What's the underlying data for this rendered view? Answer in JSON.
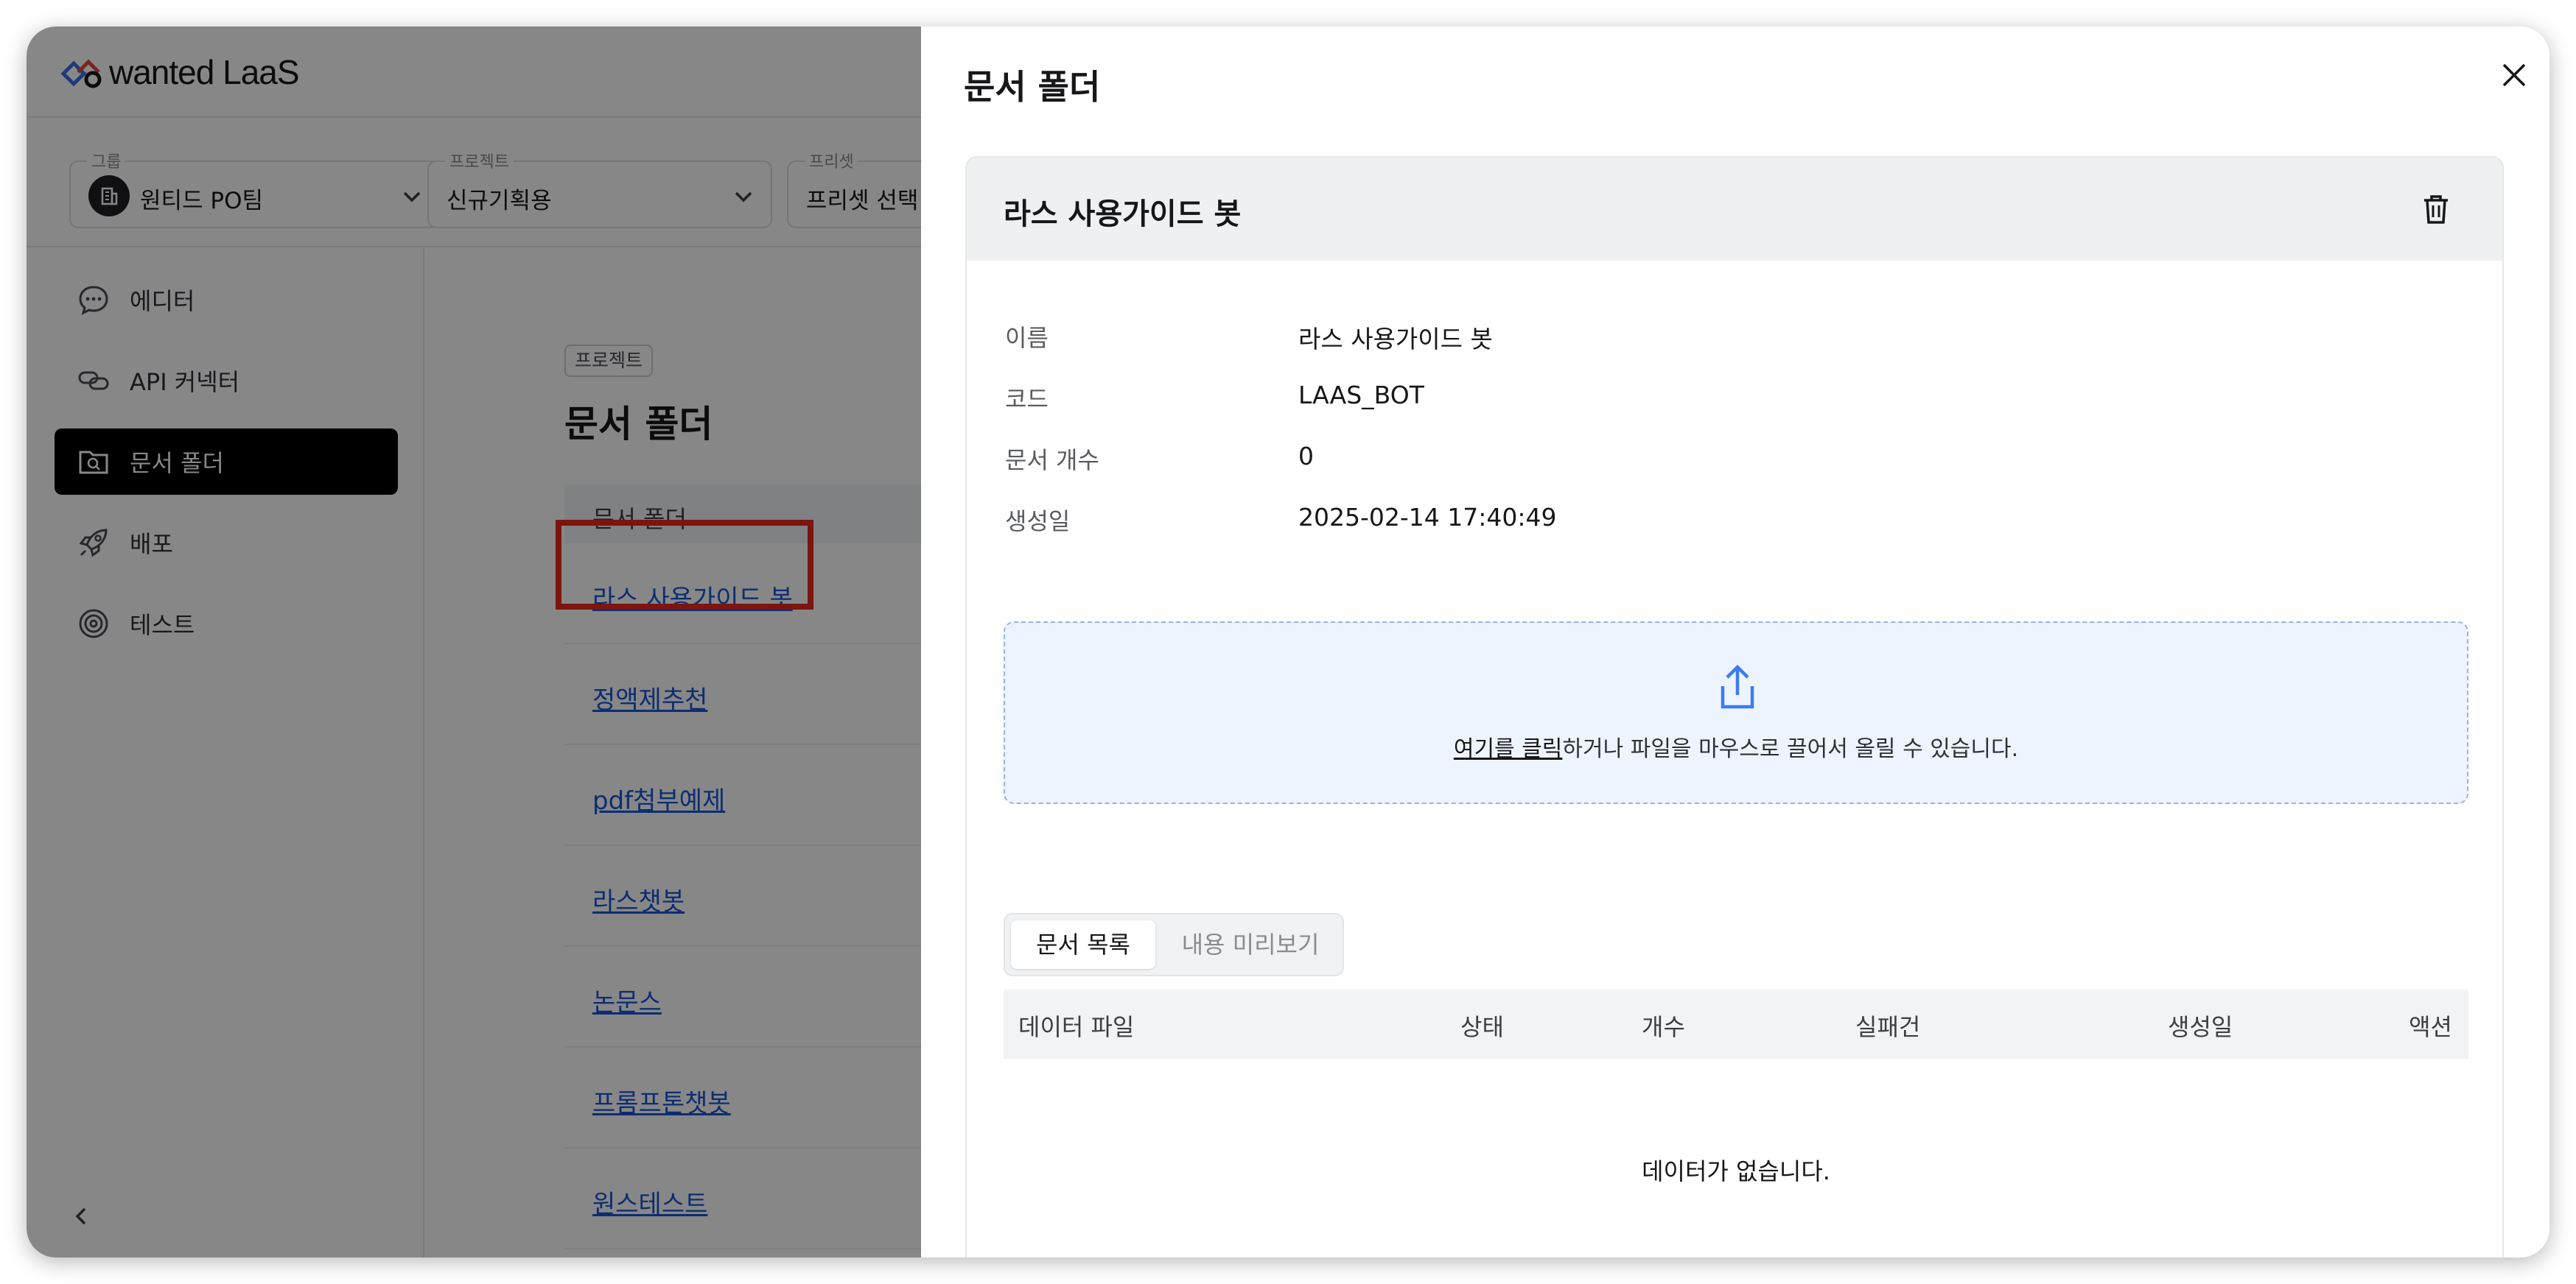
{
  "app": {
    "logo_text": "wanted LaaS"
  },
  "selectors": {
    "group": {
      "label": "그룹",
      "value": "원티드 PO팀"
    },
    "project": {
      "label": "프로젝트",
      "value": "신규기획용"
    },
    "preset": {
      "label": "프리셋",
      "value": "프리셋 선택"
    }
  },
  "sidebar": {
    "items": [
      {
        "label": "에디터",
        "icon": "chat-bubble-icon"
      },
      {
        "label": "API 커넥터",
        "icon": "link-icon"
      },
      {
        "label": "문서 폴더",
        "icon": "folder-search-icon",
        "active": true
      },
      {
        "label": "배포",
        "icon": "rocket-icon"
      },
      {
        "label": "테스트",
        "icon": "target-icon"
      }
    ],
    "collapse_icon": "chevron-left-icon"
  },
  "content": {
    "badge": "프로젝트",
    "title": "문서 폴더",
    "list_header": "문서 폴더",
    "folders": [
      "라스 사용가이드 봇",
      "정액제추천",
      "pdf첨부예제",
      "라스챗봇",
      "논문스",
      "프롬프톤챗봇",
      "원스테스트"
    ]
  },
  "drawer": {
    "title": "문서 폴더",
    "card_title": "라스 사용가이드 봇",
    "info": [
      {
        "label": "이름",
        "value": "라스 사용가이드 봇"
      },
      {
        "label": "코드",
        "value": "LAAS_BOT"
      },
      {
        "label": "문서 개수",
        "value": "0"
      },
      {
        "label": "생성일",
        "value": "2025-02-14 17:40:49"
      }
    ],
    "upload": {
      "link": "여기를 클릭",
      "text": "하거나 파일을 마우스로 끌어서 올릴 수 있습니다."
    },
    "tabs": [
      "문서 목록",
      "내용 미리보기"
    ],
    "table_headers": [
      "데이터 파일",
      "상태",
      "개수",
      "실패건",
      "생성일",
      "액션"
    ],
    "empty_text": "데이터가 없습니다."
  },
  "colors": {
    "accent_link": "#1a55d8",
    "highlight": "#e8291c",
    "upload_icon": "#3b7cf0"
  }
}
